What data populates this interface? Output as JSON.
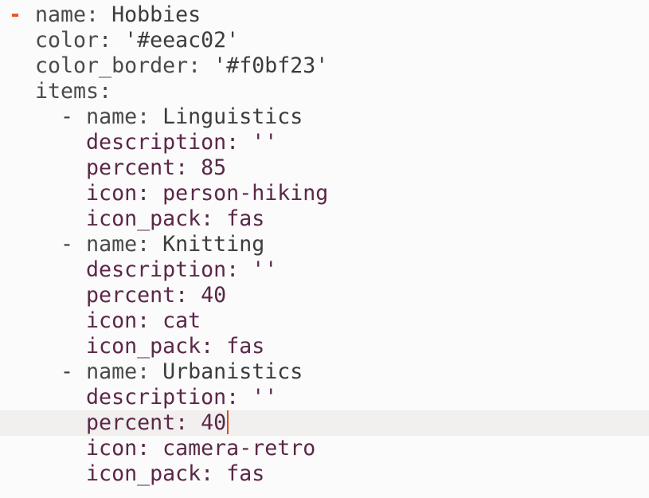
{
  "editor": {
    "cursor_line": 16,
    "lines": [
      {
        "indent": "",
        "dash": "",
        "key": "name",
        "sep": ": ",
        "value": "Hobbies",
        "bullet": "-",
        "kind": "top"
      },
      {
        "indent": "",
        "dash": "",
        "key": "color",
        "sep": ": ",
        "value": "'#eeac02'",
        "bullet": "",
        "kind": "top"
      },
      {
        "indent": "",
        "dash": "",
        "key": "color_border",
        "sep": ": ",
        "value": "'#f0bf23'",
        "bullet": "",
        "kind": "top"
      },
      {
        "indent": "",
        "dash": "",
        "key": "items",
        "sep": ":",
        "value": "",
        "bullet": "",
        "kind": "top"
      },
      {
        "indent": "  ",
        "dash": "- ",
        "key": "name",
        "sep": ": ",
        "value": "Linguistics",
        "bullet": "",
        "kind": "top"
      },
      {
        "indent": "    ",
        "dash": "",
        "key": "description",
        "sep": ": ",
        "value": "''",
        "bullet": "",
        "kind": "item"
      },
      {
        "indent": "    ",
        "dash": "",
        "key": "percent",
        "sep": ": ",
        "value": "85",
        "bullet": "",
        "kind": "item"
      },
      {
        "indent": "    ",
        "dash": "",
        "key": "icon",
        "sep": ": ",
        "value": "person-hiking",
        "bullet": "",
        "kind": "item"
      },
      {
        "indent": "    ",
        "dash": "",
        "key": "icon_pack",
        "sep": ": ",
        "value": "fas",
        "bullet": "",
        "kind": "item"
      },
      {
        "indent": "  ",
        "dash": "- ",
        "key": "name",
        "sep": ": ",
        "value": "Knitting",
        "bullet": "",
        "kind": "top"
      },
      {
        "indent": "    ",
        "dash": "",
        "key": "description",
        "sep": ": ",
        "value": "''",
        "bullet": "",
        "kind": "item"
      },
      {
        "indent": "    ",
        "dash": "",
        "key": "percent",
        "sep": ": ",
        "value": "40",
        "bullet": "",
        "kind": "item"
      },
      {
        "indent": "    ",
        "dash": "",
        "key": "icon",
        "sep": ": ",
        "value": "cat",
        "bullet": "",
        "kind": "item"
      },
      {
        "indent": "    ",
        "dash": "",
        "key": "icon_pack",
        "sep": ": ",
        "value": "fas",
        "bullet": "",
        "kind": "item"
      },
      {
        "indent": "  ",
        "dash": "- ",
        "key": "name",
        "sep": ": ",
        "value": "Urbanistics",
        "bullet": "",
        "kind": "top"
      },
      {
        "indent": "    ",
        "dash": "",
        "key": "description",
        "sep": ": ",
        "value": "''",
        "bullet": "",
        "kind": "item"
      },
      {
        "indent": "    ",
        "dash": "",
        "key": "percent",
        "sep": ": ",
        "value": "40",
        "bullet": "",
        "kind": "item"
      },
      {
        "indent": "    ",
        "dash": "",
        "key": "icon",
        "sep": ": ",
        "value": "camera-retro",
        "bullet": "",
        "kind": "item"
      },
      {
        "indent": "    ",
        "dash": "",
        "key": "icon_pack",
        "sep": ": ",
        "value": "fas",
        "bullet": "",
        "kind": "item"
      }
    ]
  }
}
